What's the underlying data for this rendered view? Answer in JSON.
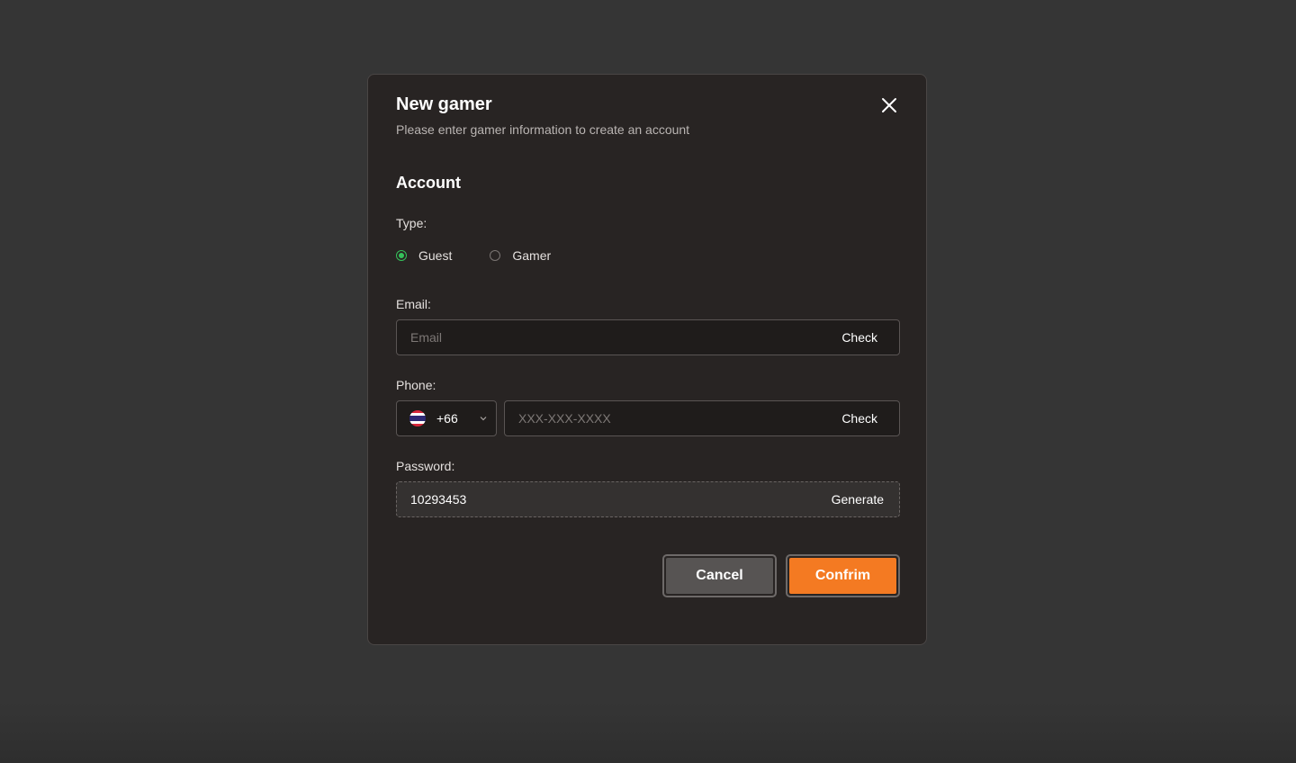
{
  "modal": {
    "title": "New gamer",
    "subtitle": "Please enter gamer information to create an account",
    "close_icon": "close-icon"
  },
  "account": {
    "section_title": "Account",
    "type_label": "Type:",
    "type_options": [
      {
        "label": "Guest",
        "checked": true
      },
      {
        "label": "Gamer",
        "checked": false
      }
    ],
    "email": {
      "label": "Email:",
      "placeholder": "Email",
      "value": "",
      "action_label": "Check"
    },
    "phone": {
      "label": "Phone:",
      "country_flag_icon": "thailand-flag-icon",
      "country_code": "+66",
      "placeholder": "XXX-XXX-XXXX",
      "value": "",
      "action_label": "Check"
    },
    "password": {
      "label": "Password:",
      "value": "10293453",
      "action_label": "Generate"
    }
  },
  "actions": {
    "cancel_label": "Cancel",
    "confirm_label": "Confrim"
  },
  "colors": {
    "page_background": "#353535",
    "modal_background": "#282423",
    "accent_confirm": "#f47a22",
    "radio_checked": "#35c25a",
    "cancel_button": "#575453"
  }
}
